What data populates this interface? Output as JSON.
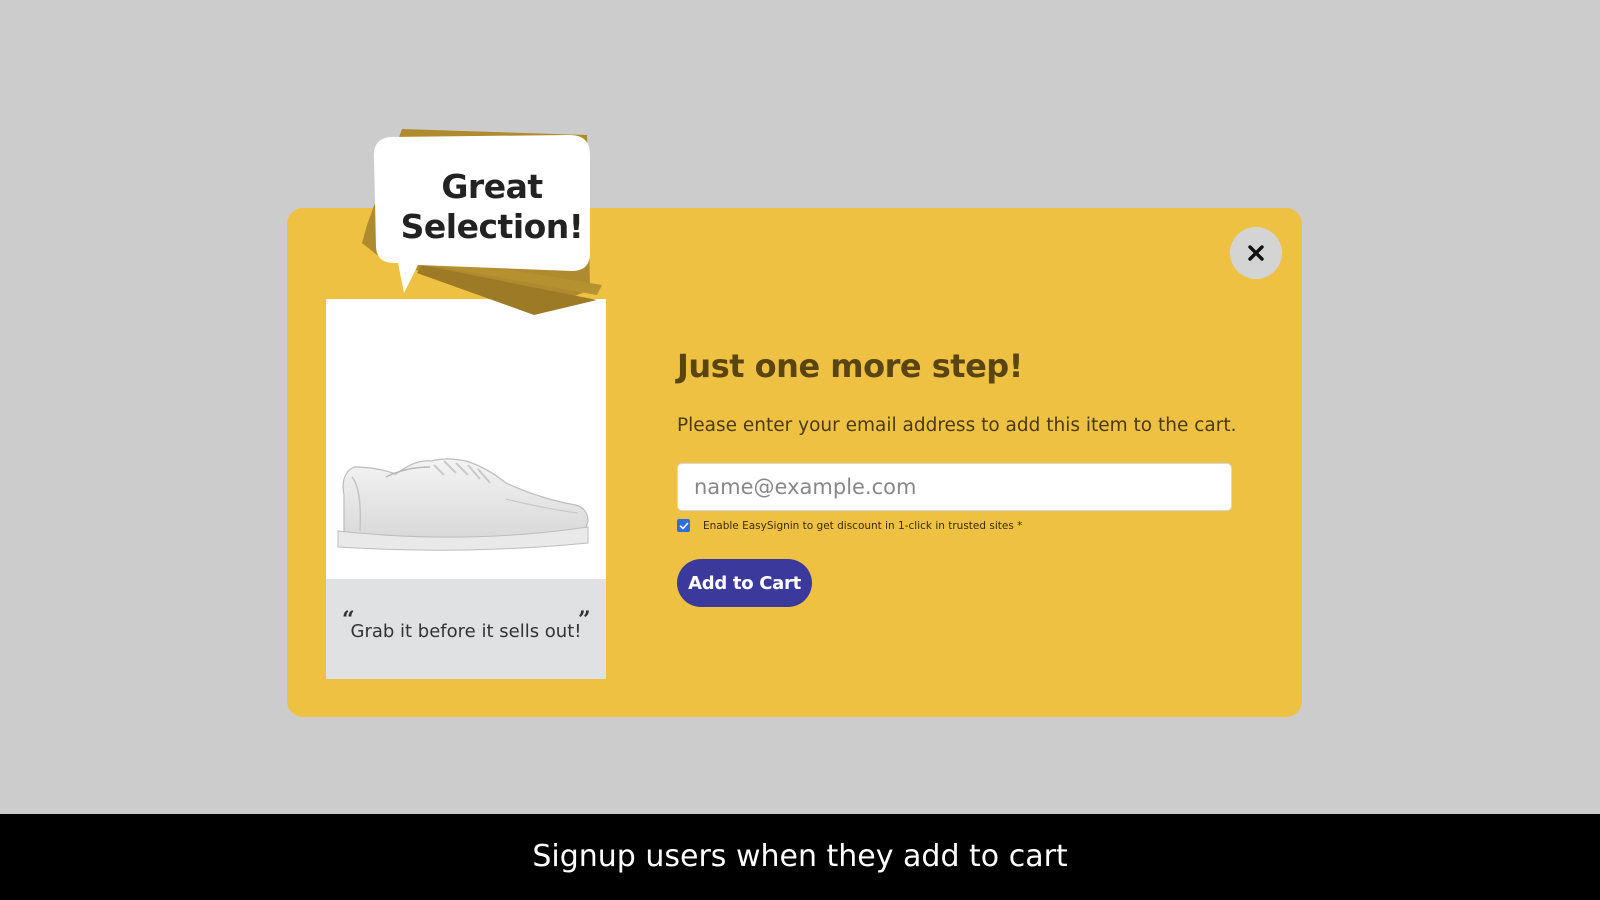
{
  "bubble": {
    "line1": "Great",
    "line2": "Selection!"
  },
  "product": {
    "image_name": "white-sneaker",
    "quote": "Grab it before it sells out!"
  },
  "modal": {
    "close_icon": "close-icon",
    "title": "Just one more step!",
    "description": "Please enter your email address to add this item to the cart.",
    "email": {
      "value": "",
      "placeholder": "name@example.com"
    },
    "consent": {
      "checked": true,
      "label": "Enable EasySignin to get discount in 1-click in trusted sites *"
    },
    "submit_label": "Add to Cart"
  },
  "caption": "Signup users when they add to cart",
  "colors": {
    "background": "#cccccc",
    "modal": "#eec143",
    "bubble_shadow": "#b08a2e",
    "button": "#3b3a9c",
    "checkbox": "#2e6fe0",
    "caption_bar": "#000000"
  }
}
